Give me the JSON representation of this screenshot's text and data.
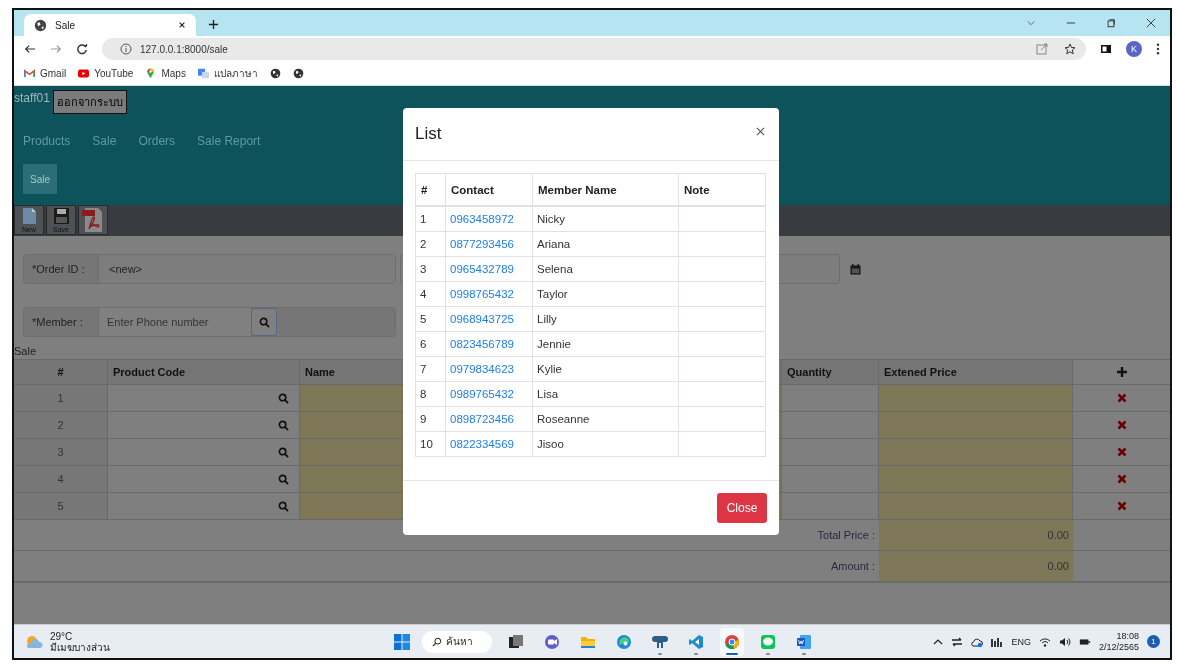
{
  "browser": {
    "tab_title": "Sale",
    "address": "127.0.0.1:8000/sale",
    "profile_initial": "K",
    "bookmarks": [
      {
        "kind": "gmail",
        "label": "Gmail"
      },
      {
        "kind": "youtube",
        "label": "YouTube"
      },
      {
        "kind": "maps",
        "label": "Maps"
      },
      {
        "kind": "translate",
        "label": "แปลภาษา"
      },
      {
        "kind": "globe"
      },
      {
        "kind": "globe"
      }
    ]
  },
  "header": {
    "user": "staff01",
    "logout_button": "ออกจากระบบ",
    "nav": [
      {
        "label": "Products"
      },
      {
        "label": "Sale"
      },
      {
        "label": "Orders"
      },
      {
        "label": "Sale Report"
      }
    ],
    "action_button": "Sale"
  },
  "toolbar": [
    {
      "kind": "new",
      "label": "New"
    },
    {
      "kind": "save",
      "label": "Save"
    },
    {
      "kind": "pdf"
    }
  ],
  "form": {
    "order_id": {
      "label": "*Order ID :",
      "value": "<new>"
    },
    "member": {
      "label": "*Member :",
      "placeholder": "Enter Phone number"
    }
  },
  "section_title": "Sale",
  "table": {
    "columns": [
      "#",
      "Product Code",
      "Name",
      "Quantity",
      "Extened Price"
    ],
    "rows": [
      {
        "number": "1"
      },
      {
        "number": "2"
      },
      {
        "number": "3"
      },
      {
        "number": "4"
      },
      {
        "number": "5"
      }
    ],
    "totals": [
      {
        "label": "Total Price :",
        "value": "0.00"
      },
      {
        "label": "Amount :",
        "value": "0.00"
      }
    ]
  },
  "modal": {
    "title": "List",
    "columns": [
      "#",
      "Contact",
      "Member Name",
      "Note"
    ],
    "rows": [
      {
        "number": "1",
        "contact": "0963458972",
        "name": "Nicky"
      },
      {
        "number": "2",
        "contact": "0877293456",
        "name": "Ariana"
      },
      {
        "number": "3",
        "contact": "0965432789",
        "name": "Selena"
      },
      {
        "number": "4",
        "contact": "0998765432",
        "name": "Taylor"
      },
      {
        "number": "5",
        "contact": "0968943725",
        "name": "Lilly"
      },
      {
        "number": "6",
        "contact": "0823456789",
        "name": "Jennie"
      },
      {
        "number": "7",
        "contact": "0979834623",
        "name": "Kylie"
      },
      {
        "number": "8",
        "contact": "0989765432",
        "name": "Lisa"
      },
      {
        "number": "9",
        "contact": "0898723456",
        "name": "Roseanne"
      },
      {
        "number": "10",
        "contact": "0822334569",
        "name": "Jisoo"
      }
    ],
    "close_button": "Close"
  },
  "taskbar": {
    "temperature": "29°C",
    "weather": "มีเมฆบางส่วน",
    "search": "ค้นหา",
    "apps": [
      {
        "kind": "taskview",
        "running": false,
        "active": false
      },
      {
        "kind": "chat",
        "running": false,
        "active": false
      },
      {
        "kind": "files",
        "running": false,
        "active": false
      },
      {
        "kind": "edge",
        "running": false,
        "active": false
      },
      {
        "kind": "database",
        "running": true,
        "active": false
      },
      {
        "kind": "code",
        "running": true,
        "active": false
      },
      {
        "kind": "browser",
        "running": true,
        "active": true
      },
      {
        "kind": "messenger",
        "running": true,
        "active": false
      },
      {
        "kind": "word",
        "running": true,
        "active": false
      }
    ],
    "language": "ENG",
    "time": "18:08",
    "date": "2/12/2565",
    "notifications": "1"
  }
}
